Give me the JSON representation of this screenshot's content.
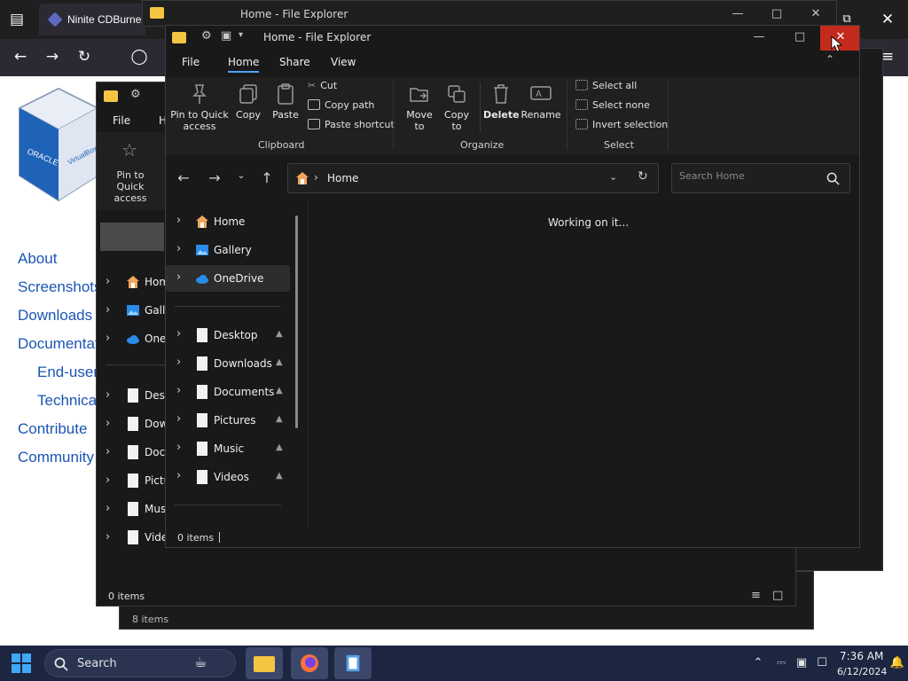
{
  "browser": {
    "tab_title": "Ninite CDBurner",
    "site_nav": [
      "About",
      "Screenshots",
      "Downloads",
      "Documentation",
      "End-user",
      "Technical",
      "Contribute",
      "Community"
    ],
    "logo_text_left": "ORACLE",
    "logo_text_right": "VirtualBox"
  },
  "back_explorer": {
    "title": "Home - File Explorer",
    "status": "8 items"
  },
  "left_explorer": {
    "menu": [
      "File",
      "H"
    ],
    "pin_label": "Pin to Quick access",
    "nav_items": [
      "Home",
      "Gallery",
      "OneDrive",
      "Desktop",
      "Downloads",
      "Documents",
      "Pictures",
      "Music",
      "Videos"
    ],
    "status": "0 items"
  },
  "main_explorer": {
    "title": "Home - File Explorer",
    "menu": [
      "File",
      "Home",
      "Share",
      "View"
    ],
    "active_menu": "Home",
    "ribbon": {
      "pin_quick_access": "Pin to Quick access",
      "copy": "Copy",
      "paste": "Paste",
      "cut": "Cut",
      "copy_path": "Copy path",
      "paste_shortcut": "Paste shortcut",
      "clipboard_group": "Clipboard",
      "move_to": "Move to",
      "copy_to": "Copy to",
      "delete": "Delete",
      "rename": "Rename",
      "organize_group": "Organize",
      "select_all": "Select all",
      "select_none": "Select none",
      "invert_selection": "Invert selection",
      "select_group": "Select"
    },
    "address": "Home",
    "search_placeholder": "Search Home",
    "nav_items": [
      {
        "label": "Home",
        "icon": "home-icon",
        "pinned": false
      },
      {
        "label": "Gallery",
        "icon": "gallery-icon",
        "pinned": false
      },
      {
        "label": "OneDrive",
        "icon": "cloud-icon",
        "pinned": false
      },
      {
        "label": "Desktop",
        "icon": "file-icon",
        "pinned": true
      },
      {
        "label": "Downloads",
        "icon": "file-icon",
        "pinned": true
      },
      {
        "label": "Documents",
        "icon": "file-icon",
        "pinned": true
      },
      {
        "label": "Pictures",
        "icon": "file-icon",
        "pinned": true
      },
      {
        "label": "Music",
        "icon": "file-icon",
        "pinned": true
      },
      {
        "label": "Videos",
        "icon": "file-icon",
        "pinned": true
      }
    ],
    "content_message": "Working on it...",
    "status": "0 items"
  },
  "taskbar": {
    "search_label": "Search",
    "time": "7:36 AM",
    "date": "6/12/2024"
  },
  "colors": {
    "accent": "#4aa3ff",
    "close_hover": "#c42b1c",
    "taskbar": "#1c2640",
    "window_bg": "#191919"
  }
}
